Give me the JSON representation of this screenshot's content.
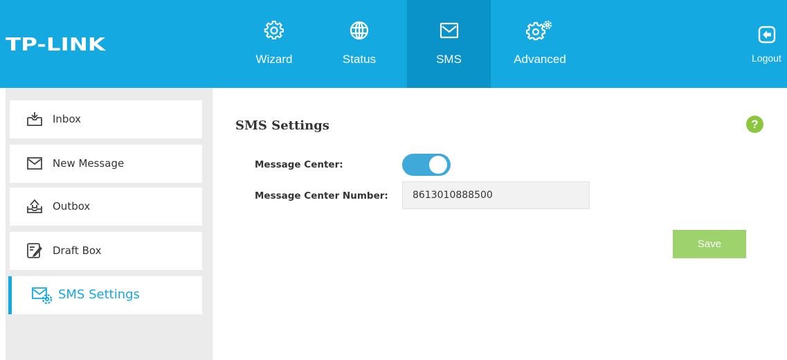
{
  "brand": {
    "logo_text": "TP-LINK"
  },
  "nav": {
    "items": [
      {
        "label": "Wizard",
        "icon": "gear-icon"
      },
      {
        "label": "Status",
        "icon": "globe-icon"
      },
      {
        "label": "SMS",
        "icon": "envelope-icon",
        "active": true
      },
      {
        "label": "Advanced",
        "icon": "double-gear-icon"
      }
    ],
    "logout_label": "Logout"
  },
  "sidebar": {
    "items": [
      {
        "label": "Inbox",
        "icon": "inbox-icon"
      },
      {
        "label": "New Message",
        "icon": "envelope-icon"
      },
      {
        "label": "Outbox",
        "icon": "outbox-icon"
      },
      {
        "label": "Draft Box",
        "icon": "draft-icon"
      },
      {
        "label": "SMS Settings",
        "icon": "sms-settings-icon",
        "active": true
      }
    ]
  },
  "main": {
    "title": "SMS Settings",
    "help_symbol": "?",
    "message_center_label": "Message Center:",
    "message_center_enabled": true,
    "message_center_number_label": "Message Center Number:",
    "message_center_number_value": "8613010888500",
    "save_label": "Save"
  },
  "colors": {
    "header": "#14a9e0",
    "active_nav": "#0993c8",
    "accent": "#14a9e0",
    "toggle_on": "#3fa9d9",
    "save_button": "#9ed26c",
    "help": "#8cc63f"
  }
}
